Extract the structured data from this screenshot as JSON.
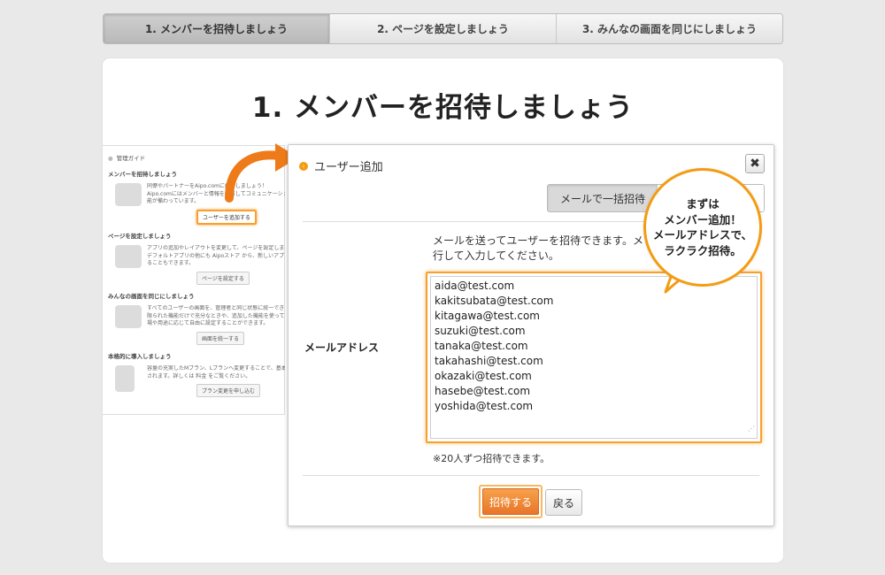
{
  "steps": [
    {
      "label": "1. メンバーを招待しましょう",
      "active": true
    },
    {
      "label": "2. ページを設定しましょう",
      "active": false
    },
    {
      "label": "3. みんなの画面を同じにしましょう",
      "active": false
    }
  ],
  "page_title": "1. メンバーを招待しましょう",
  "guide": {
    "title": "管理ガイド",
    "sections": [
      {
        "heading": "メンバーを招待しましょう",
        "lines": [
          "同僚やパートナーをAipo.comに招待しましょう！",
          "Aipo.comにはメンバーと情報を共有してコミュニケーショ",
          "能が備わっています。"
        ],
        "button": "ユーザーを追加する"
      },
      {
        "heading": "ページを設定しましょう",
        "lines": [
          "アプリの追加やレイアウトを変更して、ページを設定しまし",
          "デフォルトアプリの他にも Aipoストア から、新しいアプリ",
          "ることもできます。"
        ],
        "button": "ページを設定する"
      },
      {
        "heading": "みんなの画面を同じにしましょう",
        "lines": [
          "すべてのユーザーの画面を、管理者と同じ状態に統一できま",
          "限られた機能だけで充分なときや、追加した機能を使っては",
          "場や用途に応じて自由に設定することができます。"
        ],
        "button": "画面を統一する"
      },
      {
        "heading": "本格的に導入しましょう",
        "lines": [
          "容量の充実したMプラン、Lプランへ変更することで、基本容",
          "されます。詳しくは 料金 をご覧ください。"
        ],
        "button": "プラン変更を申し込む"
      }
    ]
  },
  "dialog": {
    "title": "ユーザー追加",
    "close_label": "✖",
    "tabs": [
      "メールで一括招待",
      ""
    ],
    "description": "メールを送ってユーザーを招待できます。メ\n行して入力してください。",
    "field_label": "メールアドレス",
    "emails": "aida@test.com\nkakitsubata@test.com\nkitagawa@test.com\nsuzuki@test.com\ntanaka@test.com\ntakahashi@test.com\nokazaki@test.com\nhasebe@test.com\nyoshida@test.com",
    "note": "※20人ずつ招待できます。",
    "invite_button": "招待する",
    "back_button": "戻る"
  },
  "callout": "まずは\nメンバー追加！\nメールアドレスで、\nラクラク招待。",
  "colors": {
    "accent": "#f39c12",
    "invite": "#ee8433",
    "background": "#e9e9e9"
  }
}
